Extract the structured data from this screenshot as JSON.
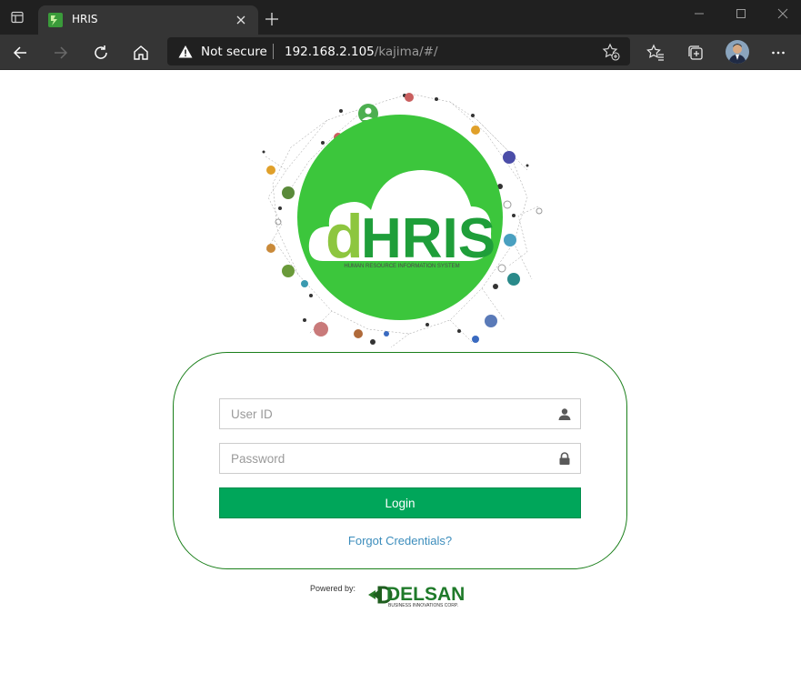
{
  "browser": {
    "tab": {
      "title": "HRIS"
    },
    "address": {
      "security_label": "Not secure",
      "url_host": "192.168.2.105",
      "url_path": "/kajima/#/"
    },
    "colors": {
      "chrome_dark": "#202020",
      "chrome_mid": "#353535"
    }
  },
  "logo": {
    "brand_d": "d",
    "brand_hris": "HRIS",
    "tagline": "HUMAN RESOURCE INFORMATION SYSTEM",
    "colors": {
      "circle": "#3cc63c",
      "d": "#8dc63f",
      "hris": "#1f9e3a"
    }
  },
  "login": {
    "user_placeholder": "User ID",
    "password_placeholder": "Password",
    "login_label": "Login",
    "forgot_label": "Forgot Credentials?",
    "colors": {
      "button": "#00a65a",
      "link": "#3c8dbc",
      "card_border": "#1a7f1a"
    }
  },
  "footer": {
    "powered_by": "Powered by:",
    "company": "DELSAN",
    "company_tagline": "BUSINESS INNOVATIONS CORP."
  },
  "icons": [
    "tab-actions-icon",
    "app-favicon-icon",
    "close-icon",
    "plus-icon",
    "minimize-icon",
    "maximize-icon",
    "window-close-icon",
    "back-arrow-icon",
    "forward-arrow-icon",
    "refresh-icon",
    "home-icon",
    "warning-icon",
    "add-favorite-icon",
    "favorites-icon",
    "collections-icon",
    "profile-avatar",
    "more-icon",
    "user-icon",
    "lock-icon"
  ]
}
